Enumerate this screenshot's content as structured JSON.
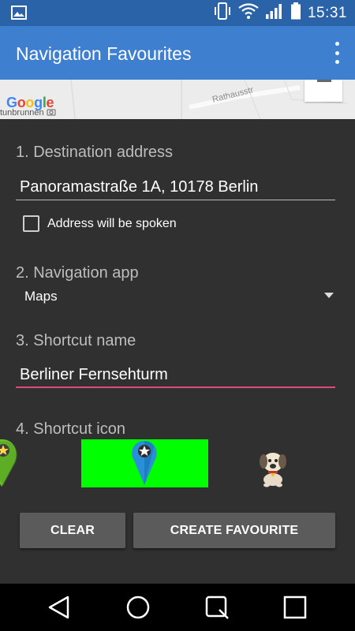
{
  "status_bar": {
    "time": "15:31",
    "icons": [
      "image-notification-icon",
      "phone-vibrate-icon",
      "wifi-icon",
      "cell-signal-icon",
      "battery-icon"
    ]
  },
  "app_bar": {
    "title": "Navigation Favourites",
    "overflow_icon": "more-vert-icon",
    "color": "#3f7fd0"
  },
  "map": {
    "logo_letters": [
      "G",
      "o",
      "o",
      "g",
      "l",
      "e"
    ],
    "street_label": "Rathausstr",
    "bottom_label": "tunbrunnen"
  },
  "form": {
    "destination": {
      "label": "1. Destination address",
      "value": "Panoramastraße 1A, 10178 Berlin"
    },
    "spoken_checkbox": {
      "label": "Address will be spoken",
      "checked": false
    },
    "navigation_app": {
      "label": "2. Navigation app",
      "selected": "Maps"
    },
    "shortcut_name": {
      "label": "3. Shortcut name",
      "value": "Berliner Fernsehturm",
      "accent_color": "#e04a7a"
    },
    "shortcut_icon": {
      "label": "4. Shortcut icon",
      "options": [
        "green-star-pin-icon",
        "blue-star-pin-icon",
        "dog-icon"
      ],
      "selected_index": 1,
      "selected_highlight_color": "#00ff00"
    }
  },
  "buttons": {
    "clear": "CLEAR",
    "create": "CREATE FAVOURITE"
  },
  "nav_bar": {
    "items": [
      "back-icon",
      "home-icon",
      "recents-icon",
      "notifications-icon"
    ]
  }
}
